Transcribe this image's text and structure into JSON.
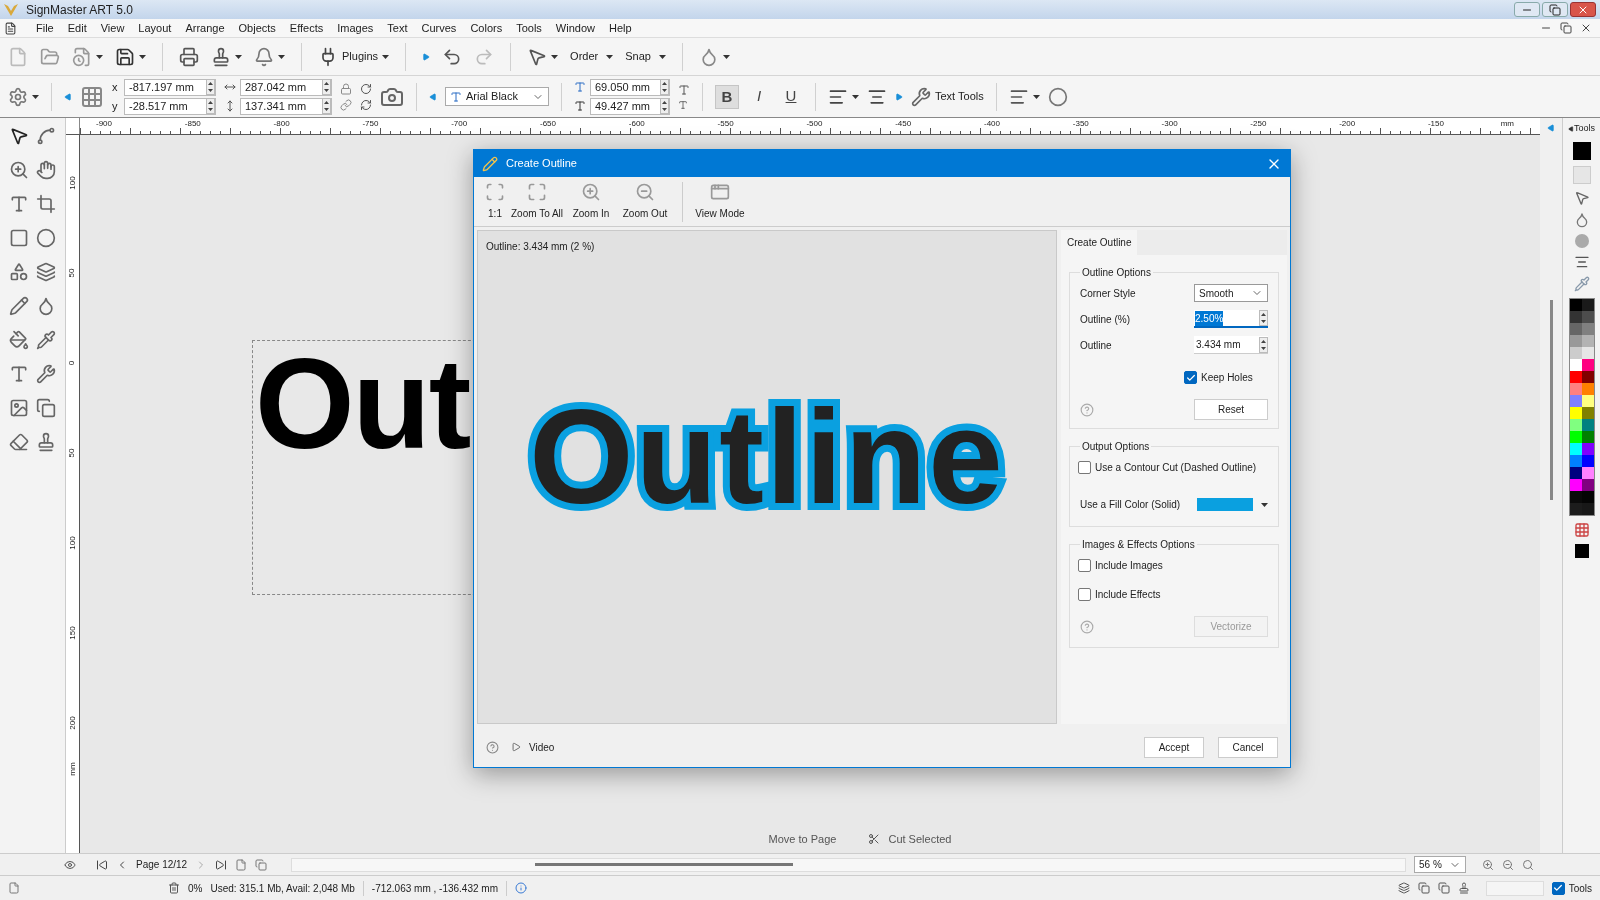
{
  "window": {
    "title": "SignMaster ART 5.0"
  },
  "menu": [
    "File",
    "Edit",
    "View",
    "Layout",
    "Arrange",
    "Objects",
    "Effects",
    "Images",
    "Text",
    "Curves",
    "Colors",
    "Tools",
    "Window",
    "Help"
  ],
  "toolbar": {
    "plugins": "Plugins",
    "order": "Order",
    "snap": "Snap"
  },
  "properties": {
    "x_label": "x",
    "x": "-817.197 mm",
    "y_label": "y",
    "y": "-28.517 mm",
    "width": "287.042 mm",
    "height": "137.341 mm",
    "font": "Arial Black",
    "font_size": "69.050 mm",
    "line_height": "49.427 mm",
    "text_tools": "Text Tools"
  },
  "format_buttons": [
    {
      "label": "B",
      "kind": "bold",
      "selected": true
    },
    {
      "label": "I",
      "kind": "italic",
      "selected": false
    },
    {
      "label": "U",
      "kind": "underline",
      "selected": false
    }
  ],
  "ruler": {
    "unit": "mm",
    "vertical_unit": "mm",
    "x_ticks": [
      "-900",
      "-850",
      "-800",
      "-750",
      "-700",
      "-650",
      "-600",
      "-550",
      "-500",
      "-450",
      "-400",
      "-350",
      "-300",
      "-250",
      "-200",
      "-150"
    ],
    "y_ticks": [
      "100",
      "50",
      "0",
      "50",
      "100",
      "150",
      "200"
    ]
  },
  "canvas": {
    "text": "Out",
    "actions": [
      "Move to Page",
      "Cut Selected"
    ]
  },
  "dialog": {
    "title": "Create Outline",
    "toolbar": [
      {
        "label": "1:1",
        "kind": "actual"
      },
      {
        "label": "Zoom To All",
        "kind": "all"
      },
      {
        "label": "Zoom In",
        "kind": "in"
      },
      {
        "label": "Zoom Out",
        "kind": "out"
      },
      {
        "label": "View Mode",
        "kind": "view"
      }
    ],
    "preview": {
      "info": "Outline: 3.434 mm (2 %)",
      "text": "Outline"
    },
    "panel": {
      "tab": "Create Outline",
      "outline_options": {
        "title": "Outline Options",
        "corner_style_label": "Corner Style",
        "corner_style": "Smooth",
        "outline_percent_label": "Outline (%)",
        "outline_percent": "2.50%",
        "outline_label": "Outline",
        "outline": "3.434 mm",
        "keep_holes": {
          "label": "Keep Holes",
          "checked": true
        },
        "reset": "Reset"
      },
      "output_options": {
        "title": "Output Options",
        "contour_cut": {
          "label": "Use a Contour Cut (Dashed Outline)",
          "checked": false
        },
        "fill_color": {
          "label": "Use a Fill Color (Solid)",
          "color": "#0aa0e0"
        }
      },
      "images_effects": {
        "title": "Images & Effects Options",
        "include_images": {
          "label": "Include Images",
          "checked": false
        },
        "include_effects": {
          "label": "Include Effects",
          "checked": false
        },
        "vectorize": {
          "label": "Vectorize",
          "disabled": true
        }
      }
    },
    "footer": {
      "video": "Video",
      "accept": "Accept",
      "cancel": "Cancel"
    }
  },
  "nav": {
    "page": "Page 12/12",
    "zoom": "56 %"
  },
  "side_panel": {
    "tab": "Tools",
    "palette": [
      {
        "color": "#000000"
      },
      {
        "color": "#1a1a1a"
      },
      {
        "color": "#333333"
      },
      {
        "color": "#4d4d4d"
      },
      {
        "color": "#666666"
      },
      {
        "color": "#808080"
      },
      {
        "color": "#999999"
      },
      {
        "color": "#b3b3b3"
      },
      {
        "color": "#cccccc"
      },
      {
        "color": "#e6e6e6"
      },
      {
        "color": "#ffffff"
      },
      {
        "color": "#ff0080"
      },
      {
        "color": "#ff0000"
      },
      {
        "color": "#800000"
      },
      {
        "color": "#ff8080"
      },
      {
        "color": "#ff8000"
      },
      {
        "color": "#8080ff"
      },
      {
        "color": "#ffff80"
      },
      {
        "color": "#ffff00"
      },
      {
        "color": "#808000"
      },
      {
        "color": "#80ff80"
      },
      {
        "color": "#008080"
      },
      {
        "color": "#00ff00"
      },
      {
        "color": "#008000"
      },
      {
        "color": "#00ffff"
      },
      {
        "color": "#8000ff"
      },
      {
        "color": "#0080ff"
      },
      {
        "color": "#0000ff"
      },
      {
        "color": "#000080"
      },
      {
        "color": "#ff80ff"
      },
      {
        "color": "#ff00ff"
      },
      {
        "color": "#800080"
      },
      {
        "color": "#0a0a0a"
      },
      {
        "color": "#050505"
      },
      {
        "color": "#1c1c1c"
      },
      {
        "color": "#181818"
      }
    ]
  },
  "status_bar": {
    "memory_percent": "0%",
    "memory": "Used: 315.1 Mb, Avail: 2,048 Mb",
    "coordinates": "-712.063 mm , -136.432 mm",
    "tools": {
      "label": "Tools",
      "checked": true
    }
  }
}
